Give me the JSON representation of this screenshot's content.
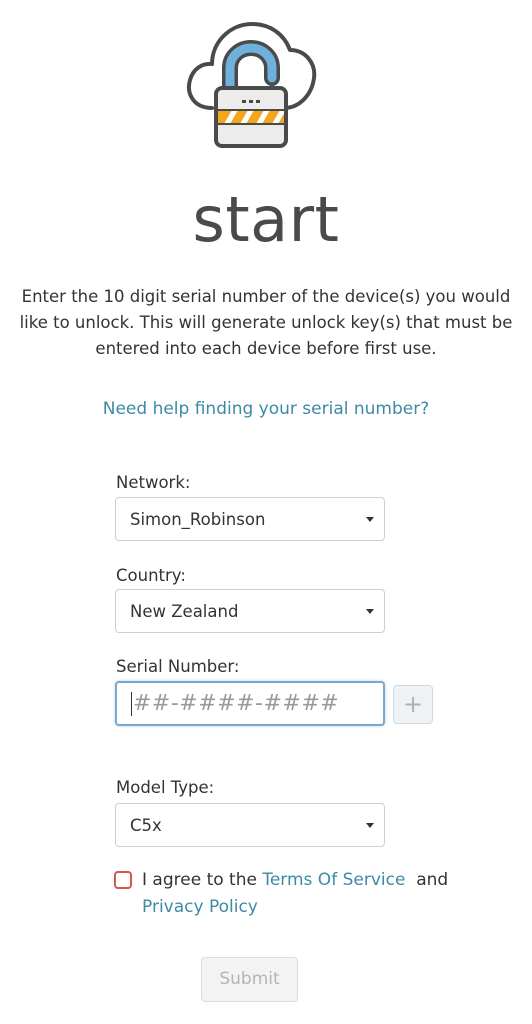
{
  "header": {
    "logo_icon": "cloud-unlock-icon",
    "title": "start"
  },
  "intro": {
    "text": "Enter the 10 digit serial number of the device(s) you would like to unlock. This will generate unlock key(s) that must be entered into each device before first use."
  },
  "help_link": "Need help finding your serial number?",
  "form": {
    "network": {
      "label": "Network:",
      "value": "Simon_Robinson"
    },
    "country": {
      "label": "Country:",
      "value": "New Zealand"
    },
    "serial": {
      "label": "Serial Number:",
      "placeholder": "##-####-####",
      "value": "",
      "add_label": "+"
    },
    "model": {
      "label": "Model Type:",
      "value": "C5x"
    },
    "agree": {
      "checked": false,
      "prefix": "I agree to the",
      "terms_link": "Terms Of Service",
      "middle": "and",
      "privacy_link": "Privacy Policy"
    },
    "submit_label": "Submit"
  },
  "colors": {
    "link": "#3d8aa6",
    "accent_blue": "#6fb1dd",
    "stripe_orange": "#f5a61f",
    "error_red": "#d9534f"
  }
}
